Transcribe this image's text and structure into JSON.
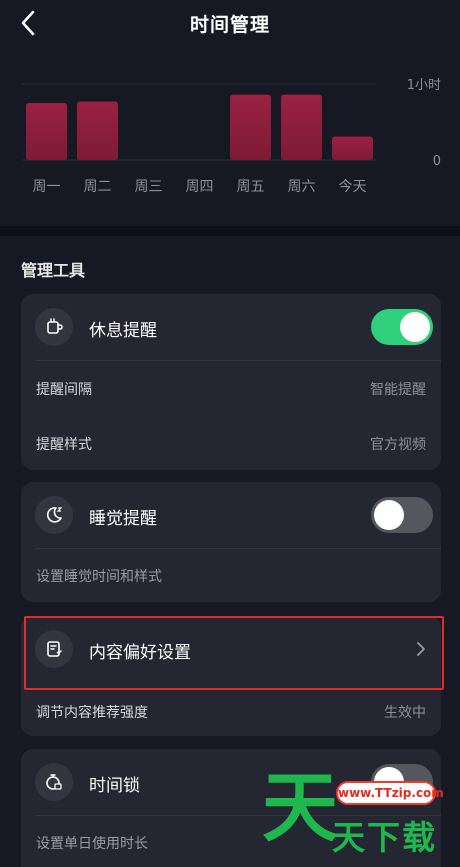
{
  "header": {
    "title": "时间管理",
    "back_icon": "chevron-left-icon"
  },
  "chart_data": {
    "type": "bar",
    "categories": [
      "周一",
      "周二",
      "周三",
      "周四",
      "周五",
      "周六",
      "今天"
    ],
    "values": [
      0.75,
      0.77,
      0,
      0,
      0.86,
      0.86,
      0.31
    ],
    "y_tick_labels": [
      "1小时",
      "0"
    ],
    "ylim": [
      0,
      1
    ],
    "yunit": "hours",
    "grid": true,
    "bar_color": "#7e1a36",
    "bar_color_top": "#9a2142"
  },
  "section": {
    "title": "管理工具"
  },
  "rest_card": {
    "icon": "coffee-cup-icon",
    "label": "休息提醒",
    "toggle_on": true,
    "interval_label": "提醒间隔",
    "interval_value": "智能提醒",
    "style_label": "提醒样式",
    "style_value": "官方视频"
  },
  "sleep_card": {
    "icon": "moon-icon",
    "label": "睡觉提醒",
    "toggle_on": false,
    "sub_label": "设置睡觉时间和样式"
  },
  "content_card": {
    "icon": "content-preference-icon",
    "label": "内容偏好设置",
    "sub_label": "调节内容推荐强度",
    "sub_value": "生效中"
  },
  "lock_card": {
    "icon": "timer-lock-icon",
    "label": "时间锁",
    "toggle_on": false,
    "sub_label": "设置单日使用时长"
  },
  "watermark": {
    "url": "www.TTzip.com",
    "big_char": "天",
    "small_text": "天下载"
  },
  "colors": {
    "background": "#161823",
    "card": "#242631",
    "toggle_on": "#2fcf7b",
    "toggle_off": "#55575f",
    "highlight": "#e52a2a",
    "watermark_green": "#1eb84f"
  }
}
